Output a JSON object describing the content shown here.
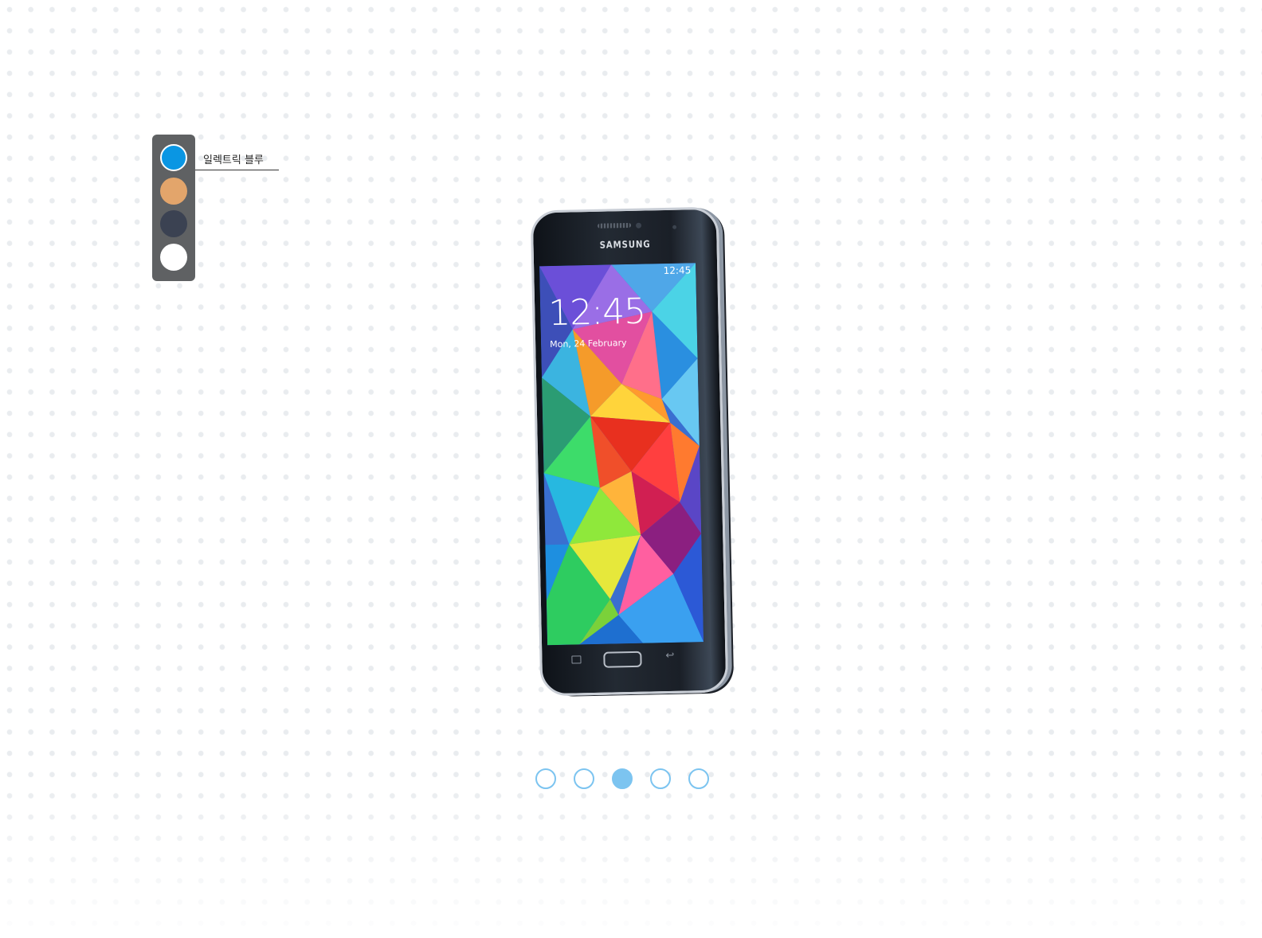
{
  "colors": {
    "selected_label": "일렉트릭 블루",
    "swatches": [
      {
        "name": "electric-blue",
        "hex": "#0a96e3",
        "selected": true
      },
      {
        "name": "copper-gold",
        "hex": "#e3a56b",
        "selected": false
      },
      {
        "name": "charcoal-black",
        "hex": "#3b4252",
        "selected": false
      },
      {
        "name": "shimmery-white",
        "hex": "#ffffff",
        "selected": false
      }
    ]
  },
  "phone": {
    "brand": "SAMSUNG",
    "status_time": "12:45",
    "lock_time": "12:45",
    "lock_date": "Mon, 24 February"
  },
  "pager": {
    "count": 5,
    "active_index": 2,
    "active_color": "#7cc4f0"
  }
}
